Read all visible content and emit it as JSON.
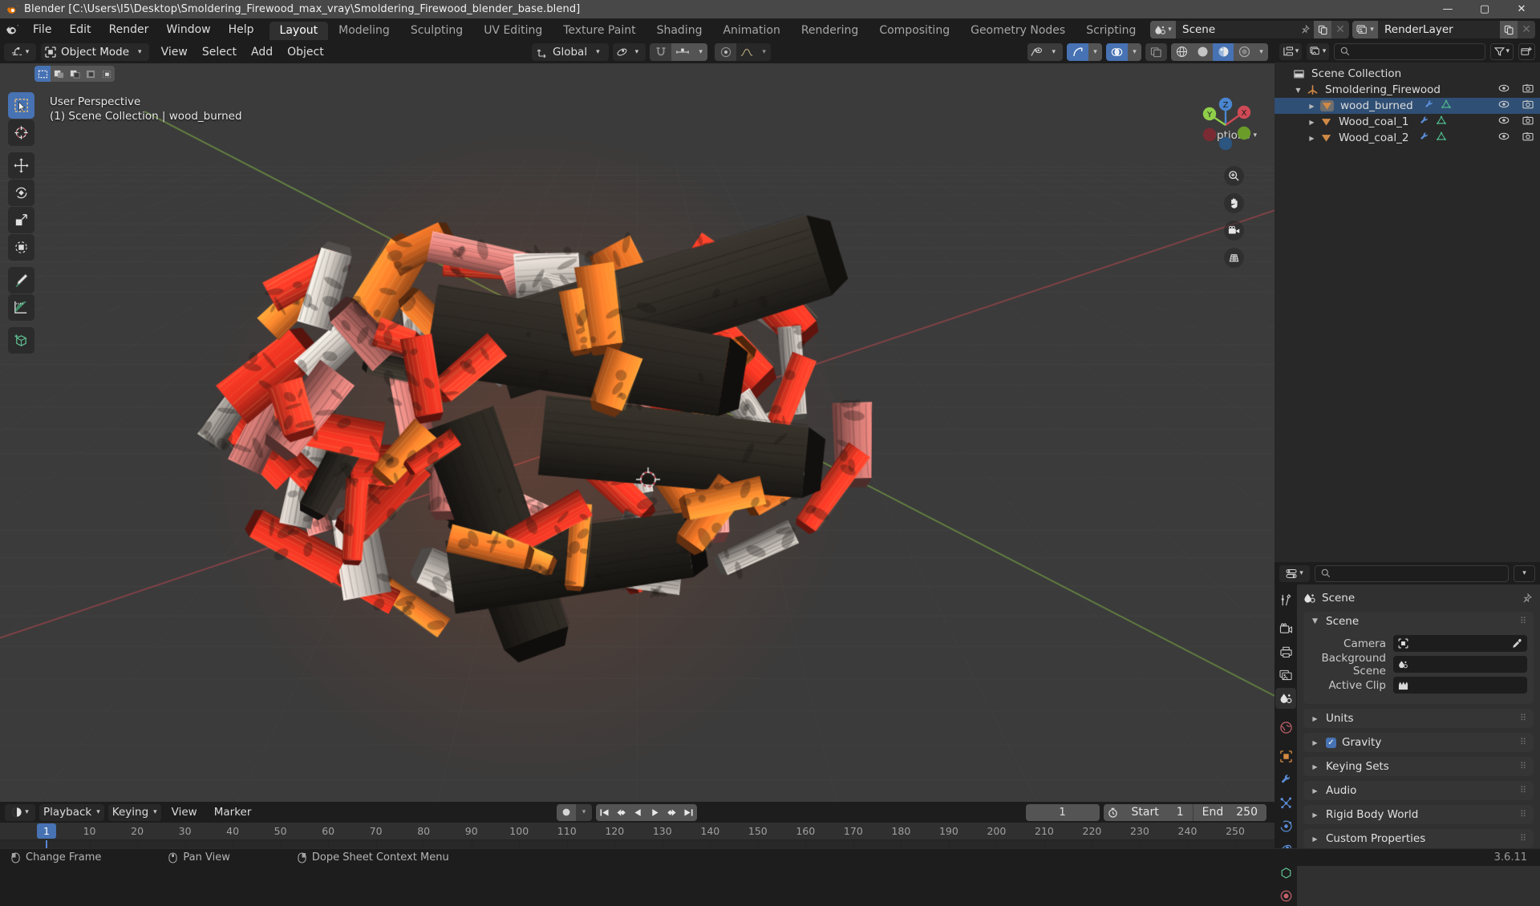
{
  "window": {
    "title": "Blender [C:\\Users\\I5\\Desktop\\Smoldering_Firewood_max_vray\\Smoldering_Firewood_blender_base.blend]",
    "minimize": "—",
    "maximize": "▢",
    "close": "✕"
  },
  "topbar": {
    "menus": [
      "File",
      "Edit",
      "Render",
      "Window",
      "Help"
    ],
    "workspaces": [
      "Layout",
      "Modeling",
      "Sculpting",
      "UV Editing",
      "Texture Paint",
      "Shading",
      "Animation",
      "Rendering",
      "Compositing",
      "Geometry Nodes",
      "Scripting"
    ],
    "active_workspace": "Layout",
    "add_workspace": "+",
    "scene_name": "Scene",
    "view_layer_name": "RenderLayer"
  },
  "viewport_header": {
    "mode": "Object Mode",
    "menus": [
      "View",
      "Select",
      "Add",
      "Object"
    ],
    "transform_orientation": "Global",
    "options_label": "Options"
  },
  "viewport": {
    "perspective_text": "User Perspective",
    "collection_text": "(1) Scene Collection | wood_burned",
    "gizmo_axes": {
      "x": "X",
      "y": "Y",
      "z": "Z"
    }
  },
  "outliner": {
    "search_placeholder": "",
    "tree": [
      {
        "label": "Scene Collection",
        "depth": 0,
        "icon": "collection-icon",
        "expanded": true,
        "selected": false,
        "has_visibility": false
      },
      {
        "label": "Smoldering_Firewood",
        "depth": 1,
        "icon": "empty-axes-icon",
        "expanded": true,
        "selected": false,
        "has_visibility": true
      },
      {
        "label": "wood_burned",
        "depth": 2,
        "icon": "mesh-data-icon",
        "expanded": false,
        "selected": true,
        "has_visibility": true
      },
      {
        "label": "Wood_coal_1",
        "depth": 2,
        "icon": "mesh-data-icon",
        "expanded": false,
        "selected": false,
        "has_visibility": true
      },
      {
        "label": "Wood_coal_2",
        "depth": 2,
        "icon": "mesh-data-icon",
        "expanded": false,
        "selected": false,
        "has_visibility": true
      }
    ]
  },
  "properties": {
    "search_placeholder": "",
    "breadcrumb": "Scene",
    "panels": [
      {
        "label": "Scene",
        "expanded": true
      },
      {
        "label": "Units",
        "expanded": false
      },
      {
        "label": "Gravity",
        "expanded": false,
        "checkbox": true
      },
      {
        "label": "Keying Sets",
        "expanded": false
      },
      {
        "label": "Audio",
        "expanded": false
      },
      {
        "label": "Rigid Body World",
        "expanded": false
      },
      {
        "label": "Custom Properties",
        "expanded": false
      }
    ],
    "scene_fields": [
      {
        "label": "Camera",
        "value": "",
        "icon": "camera-icon",
        "eyedropper": true
      },
      {
        "label": "Background Scene",
        "value": "",
        "icon": "scene-icon",
        "eyedropper": false
      },
      {
        "label": "Active Clip",
        "value": "",
        "icon": "clip-icon",
        "eyedropper": false
      }
    ]
  },
  "timeline": {
    "menus": [
      "Playback",
      "Keying",
      "View",
      "Marker"
    ],
    "current_frame": "1",
    "start_label": "Start",
    "start_value": "1",
    "end_label": "End",
    "end_value": "250",
    "ticks": [
      1,
      10,
      20,
      30,
      40,
      50,
      60,
      70,
      80,
      90,
      100,
      110,
      120,
      130,
      140,
      150,
      160,
      170,
      180,
      190,
      200,
      210,
      220,
      230,
      240,
      250
    ],
    "playhead_frame": 1
  },
  "statusbar": {
    "items": [
      {
        "icon": "mouse-left-icon",
        "label": "Change Frame"
      },
      {
        "icon": "mouse-middle-icon",
        "label": "Pan View"
      },
      {
        "icon": "mouse-right-icon",
        "label": "Dope Sheet Context Menu"
      }
    ],
    "version": "3.6.11"
  },
  "colors": {
    "accent_blue": "#4772b3",
    "header_bg": "#1d1d1d",
    "panel_bg": "#303030",
    "field_bg": "#282828",
    "viewport_bg": "#3b3b3b",
    "ember_red": "#e8372a",
    "ember_orange": "#ff7a2a",
    "charcoal": "#2e2b26",
    "axis_x": "#cf4a55",
    "axis_y": "#8fcf4a",
    "axis_z": "#4a86cf"
  }
}
